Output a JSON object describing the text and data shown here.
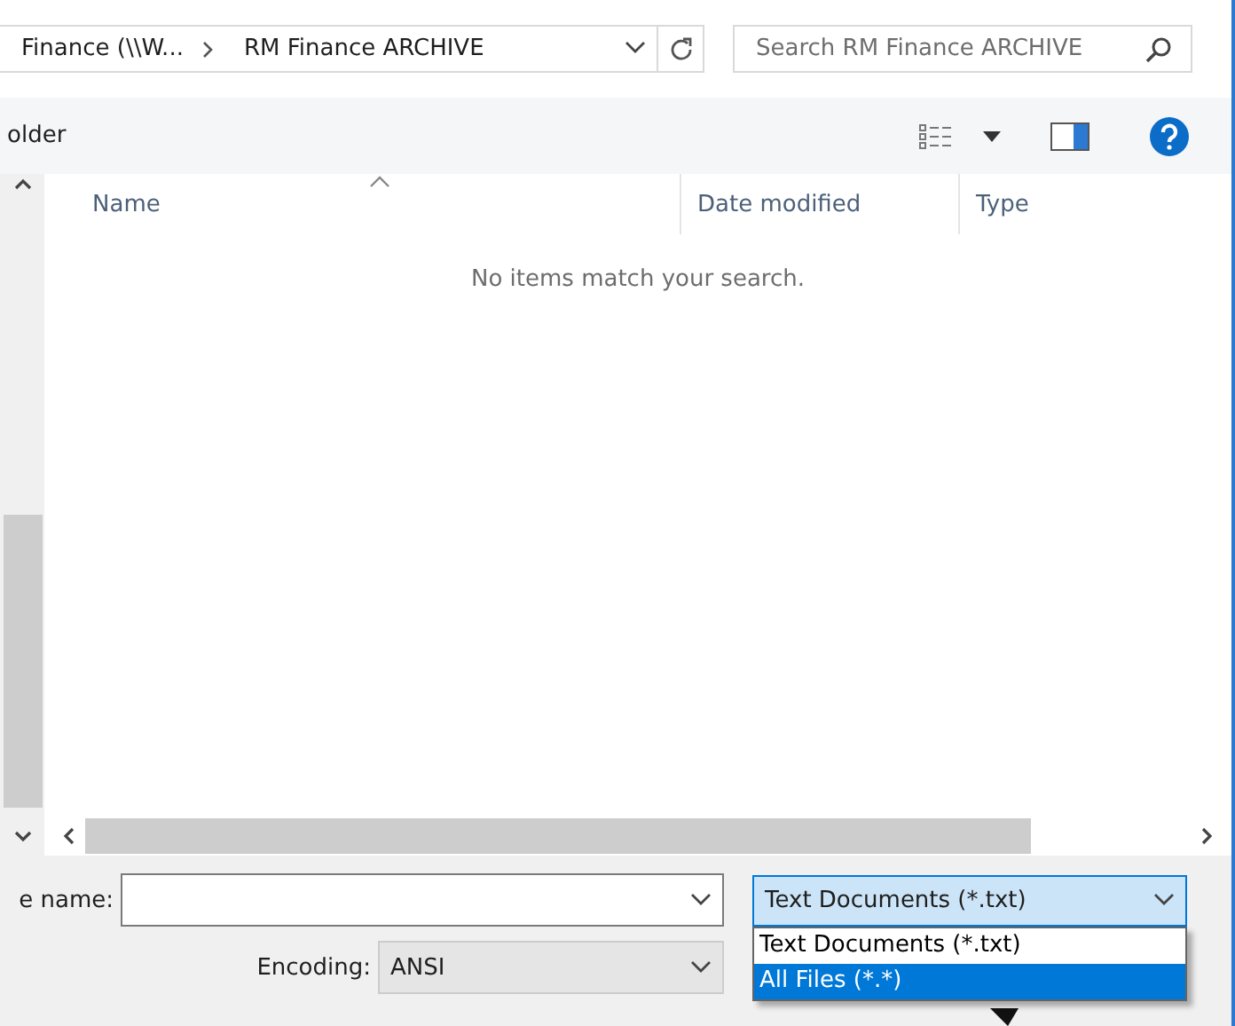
{
  "address": {
    "crumbs": [
      "Finance (\\\\W...",
      "RM Finance ARCHIVE"
    ]
  },
  "search": {
    "placeholder": "Search RM Finance ARCHIVE"
  },
  "toolbar": {
    "label": "older"
  },
  "columns": [
    "Name",
    "Date modified",
    "Type"
  ],
  "empty_message": "No items match your search.",
  "file_name": {
    "label": "e name:"
  },
  "file_type": {
    "value": "Text Documents (*.txt)",
    "expanded": true,
    "options": [
      {
        "label": "Text Documents (*.txt)",
        "highlighted": false
      },
      {
        "label": "All Files  (*.*)",
        "highlighted": true
      }
    ]
  },
  "encoding": {
    "label": "Encoding:",
    "value": "ANSI"
  }
}
